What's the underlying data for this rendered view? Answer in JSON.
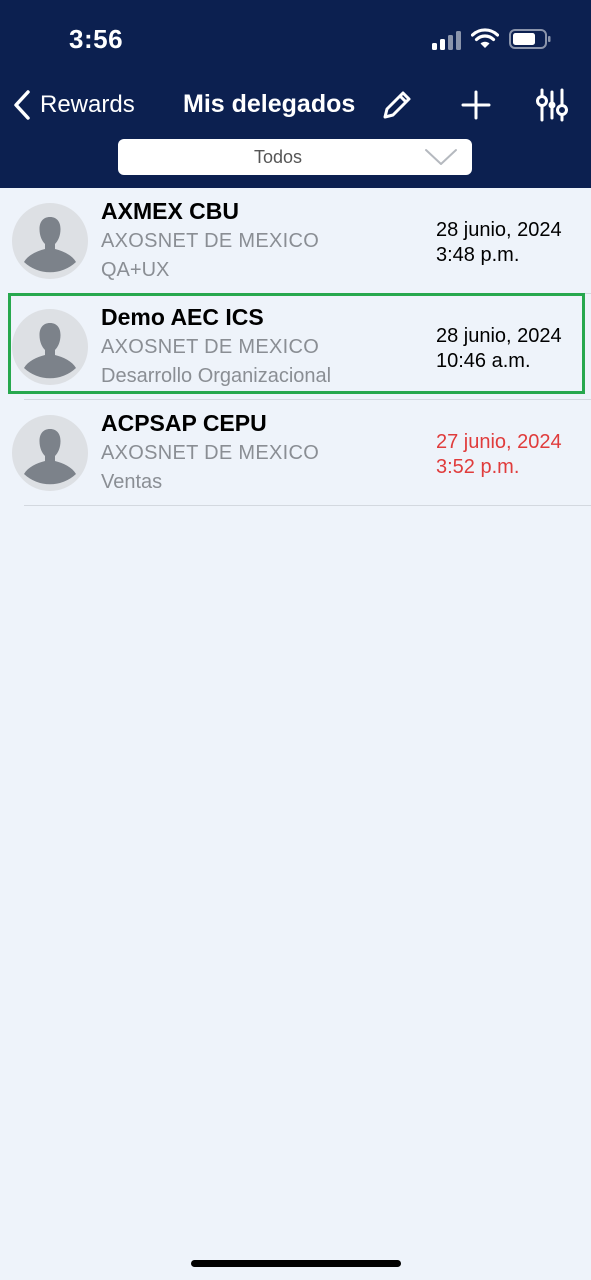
{
  "status_bar": {
    "time": "3:56"
  },
  "nav": {
    "back_label": "Rewards",
    "title": "Mis delegados",
    "icons": [
      "pencil-icon",
      "plus-icon",
      "sliders-icon"
    ]
  },
  "filter": {
    "value": "Todos"
  },
  "delegates": [
    {
      "name": "AXMEX CBU",
      "company": "AXOSNET DE MEXICO",
      "department": "QA+UX",
      "date": "28 junio, 2024",
      "time": "3:48 p.m.",
      "overdue": false
    },
    {
      "name": "Demo AEC ICS",
      "company": "AXOSNET DE MEXICO",
      "department": "Desarrollo Organizacional",
      "date": "28 junio, 2024",
      "time": "10:46 a.m.",
      "overdue": false
    },
    {
      "name": "ACPSAP CEPU",
      "company": "AXOSNET DE MEXICO",
      "department": "Ventas",
      "date": "27 junio, 2024",
      "time": "3:52 p.m.",
      "overdue": true
    }
  ],
  "colors": {
    "header": "#0c2050",
    "background": "#eef3fa",
    "highlight": "#27a84e",
    "overdue": "#e03c3c"
  }
}
